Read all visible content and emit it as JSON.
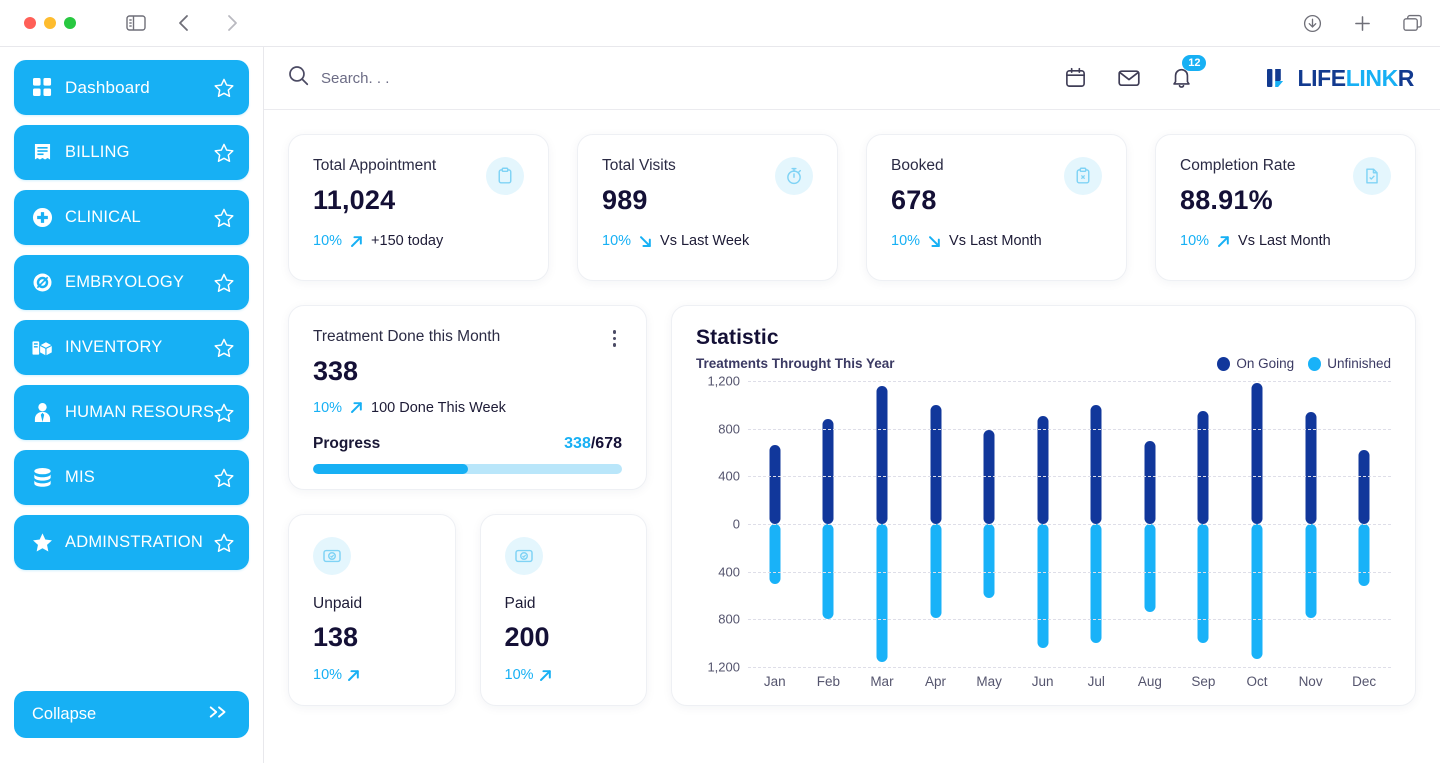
{
  "browser": {
    "sidebar_toggle_icon": "sidebar-panel-icon",
    "back_icon": "chevron-left-icon",
    "forward_icon": "chevron-right-icon",
    "download_icon": "download-icon",
    "new_tab_icon": "plus-icon",
    "tabs_icon": "tab-overview-icon"
  },
  "sidebar": {
    "items": [
      {
        "label": "Dashboard",
        "icon": "grid-icon"
      },
      {
        "label": "BILLING",
        "icon": "receipt-icon"
      },
      {
        "label": "CLINICAL",
        "icon": "medical-cross-icon"
      },
      {
        "label": "EMBRYOLOGY",
        "icon": "microscope-icon"
      },
      {
        "label": "INVENTORY",
        "icon": "boxes-icon"
      },
      {
        "label": "HUMAN RESOURSE",
        "icon": "person-tie-icon"
      },
      {
        "label": "MIS",
        "icon": "database-icon"
      },
      {
        "label": "ADMINSTRATION",
        "icon": "star-filled-icon"
      }
    ],
    "star_icon": "star-outline-icon",
    "collapse": {
      "label": "Collapse",
      "icon": "double-chevron-right-icon"
    }
  },
  "topbar": {
    "search": {
      "placeholder": "Search. . .",
      "value": "",
      "icon": "search-icon"
    },
    "calendar_icon": "calendar-icon",
    "mail_icon": "envelope-icon",
    "bell_icon": "bell-icon",
    "notification_count": "12",
    "logo": {
      "part1": "LIFE",
      "part2": "LINK",
      "part3": "R",
      "mark": "lifelinkr-logo-mark"
    }
  },
  "kpis": [
    {
      "title": "Total Appointment",
      "value": "11,024",
      "pct": "10%",
      "trend": "up",
      "sub": "+150 today",
      "icon": "clipboard-icon"
    },
    {
      "title": "Total Visits",
      "value": "989",
      "pct": "10%",
      "trend": "down",
      "sub": "Vs Last Week",
      "icon": "stopwatch-icon"
    },
    {
      "title": "Booked",
      "value": "678",
      "pct": "10%",
      "trend": "down",
      "sub": "Vs Last Month",
      "icon": "clipboard-x-icon"
    },
    {
      "title": "Completion Rate",
      "value": "88.91%",
      "pct": "10%",
      "trend": "up",
      "sub": "Vs Last Month",
      "icon": "file-check-icon"
    }
  ],
  "treatment": {
    "title": "Treatment Done this Month",
    "menu_icon": "kebab-menu-icon",
    "value": "338",
    "pct": "10%",
    "trend": "up",
    "sub": "100 Done This Week",
    "progress_label": "Progress",
    "progress_current": "338",
    "progress_separator": "/",
    "progress_total": "678",
    "progress_percent": 50
  },
  "payments": [
    {
      "title": "Unpaid",
      "value": "138",
      "pct": "10%",
      "trend": "up",
      "icon": "money-check-icon"
    },
    {
      "title": "Paid",
      "value": "200",
      "pct": "10%",
      "trend": "up",
      "icon": "money-check-icon"
    }
  ],
  "colors": {
    "brand_light": "#17b0f4",
    "brand_dark": "#11379b",
    "logo_navy": "#123a8f",
    "text_dark": "#141036"
  },
  "chart_data": {
    "type": "bar",
    "title": "Statistic",
    "subtitle": "Treatments Throught This Year",
    "xlabel": "",
    "ylabel": "",
    "grid": true,
    "legend_position": "top-right",
    "orientation": "diverging-vertical",
    "axis_ticks": [
      "1,200",
      "800",
      "400",
      "0",
      "400",
      "800",
      "1,200"
    ],
    "ylim": [
      -1200,
      1200
    ],
    "categories": [
      "Jan",
      "Feb",
      "Mar",
      "Apr",
      "May",
      "Jun",
      "Jul",
      "Aug",
      "Sep",
      "Oct",
      "Nov",
      "Dec"
    ],
    "series": [
      {
        "name": "On Going",
        "color": "#11379b",
        "direction": "up",
        "values": [
          660,
          880,
          1160,
          1000,
          790,
          910,
          1000,
          700,
          950,
          1180,
          940,
          620
        ]
      },
      {
        "name": "Unfinished",
        "color": "#19b2f8",
        "direction": "down",
        "values": [
          -500,
          -800,
          -1160,
          -790,
          -620,
          -1040,
          -1000,
          -740,
          -1000,
          -1130,
          -790,
          -520
        ]
      }
    ]
  }
}
